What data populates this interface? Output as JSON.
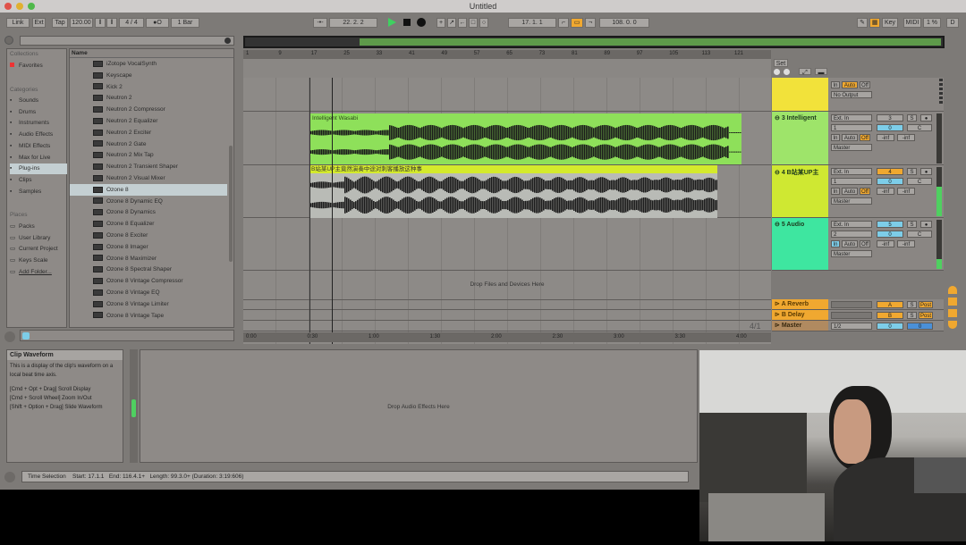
{
  "window": {
    "title": "Untitled"
  },
  "toolbar": {
    "link": "Link",
    "ext": "Ext",
    "tap": "Tap",
    "tempo": "120.00",
    "signature": "4 / 4",
    "metro": "●O",
    "quantize": "1 Bar",
    "position": "22.  2.  2",
    "loop_start": "17.  1.  1",
    "loop_length": "108.  0.  0",
    "key": "Key",
    "midi": "MIDI",
    "cpu": "1 %",
    "d": "D"
  },
  "browser": {
    "collections_label": "Collections",
    "favorites": "Favorites",
    "categories_label": "Categories",
    "categories": [
      "Sounds",
      "Drums",
      "Instruments",
      "Audio Effects",
      "MIDI Effects",
      "Max for Live",
      "Plug-ins",
      "Clips",
      "Samples"
    ],
    "places_label": "Places",
    "places": [
      "Packs",
      "User Library",
      "Current Project",
      "Keys Scale",
      "Add Folder..."
    ],
    "name_header": "Name",
    "items": [
      "iZotope VocalSynth",
      "Keyscape",
      "Kick 2",
      "Neutron 2",
      "Neutron 2 Compressor",
      "Neutron 2 Equalizer",
      "Neutron 2 Exciter",
      "Neutron 2 Gate",
      "Neutron 2 Mix Tap",
      "Neutron 2 Transient Shaper",
      "Neutron 2 Visual Mixer",
      "Ozone 8",
      "Ozone 8 Dynamic EQ",
      "Ozone 8 Dynamics",
      "Ozone 8 Equalizer",
      "Ozone 8 Exciter",
      "Ozone 8 Imager",
      "Ozone 8 Maximizer",
      "Ozone 8 Spectral Shaper",
      "Ozone 8 Vintage Compressor",
      "Ozone 8 Vintage EQ",
      "Ozone 8 Vintage Limiter",
      "Ozone 8 Vintage Tape"
    ],
    "selected_item": "Ozone 8",
    "selected_category": "Plug-ins"
  },
  "arrangement": {
    "bar_ticks": [
      "1",
      "9",
      "17",
      "25",
      "33",
      "41",
      "49",
      "57",
      "65",
      "73",
      "81",
      "89",
      "97",
      "105",
      "113",
      "121"
    ],
    "time_ticks": [
      "0:00",
      "0:30",
      "1:00",
      "1:30",
      "2:00",
      "2:30",
      "3:00",
      "3:30",
      "4:00"
    ],
    "clips": [
      {
        "name": "Intelligent Wasabi",
        "color": "#8ee05a"
      },
      {
        "name": "B站某UP主竟然演奏中途对刺客播放这种事",
        "color": "#d4ea2c"
      }
    ],
    "drop_hint": "Drop Files and Devices Here",
    "zoom_label": "4/1"
  },
  "mixer": {
    "set": "Set",
    "tracks": [
      {
        "name": "",
        "color": "#f2e23a",
        "in": "In",
        "auto": "Auto",
        "off": "Off",
        "output": "No Output"
      },
      {
        "name": "3 Intelligent",
        "color": "#9ee46a",
        "input": "Ext. In",
        "channel": "1",
        "in": "In",
        "auto": "Auto",
        "off": "Off",
        "output": "Master",
        "number": "3",
        "solo": "S",
        "vol": "0",
        "pan": "C",
        "peak1": "-inf",
        "peak2": "-inf"
      },
      {
        "name": "4 B站某UP主",
        "color": "#cfe832",
        "input": "Ext. In",
        "channel": "1",
        "in": "In",
        "auto": "Auto",
        "off": "Off",
        "output": "Master",
        "number": "4",
        "solo": "S",
        "vol": "0",
        "pan": "C",
        "peak1": "-inf",
        "peak2": "-inf"
      },
      {
        "name": "5 Audio",
        "color": "#3ee6a0",
        "input": "Ext. In",
        "channel": "2",
        "in": "In",
        "auto": "Auto",
        "off": "Off",
        "output": "Master",
        "number": "5",
        "solo": "S",
        "vol": "0",
        "pan": "C",
        "peak1": "-inf",
        "peak2": "-inf"
      }
    ],
    "returns": [
      {
        "name": "A Reverb",
        "letter": "A",
        "solo": "S",
        "post": "Post"
      },
      {
        "name": "B Delay",
        "letter": "B",
        "solo": "S",
        "post": "Post"
      }
    ],
    "master": {
      "name": "Master",
      "output": "1/2",
      "vol": "0",
      "pan": "0"
    }
  },
  "info": {
    "title": "Clip Waveform",
    "body": "This is a display of the clip's waveform on a local beat time axis.",
    "hints": [
      "[Cmd + Opt + Drag] Scroll Display",
      "[Cmd + Scroll Wheel] Zoom In/Out",
      "[Shift + Option + Drag] Slide Waveform"
    ]
  },
  "device": {
    "drop_hint": "Drop Audio Effects Here"
  },
  "status": {
    "label": "Time Selection",
    "start": "Start: 17.1.1",
    "end": "End: 116.4.1+",
    "length": "Length: 99.3.0+",
    "duration": "(Duration: 3:19:606)"
  }
}
